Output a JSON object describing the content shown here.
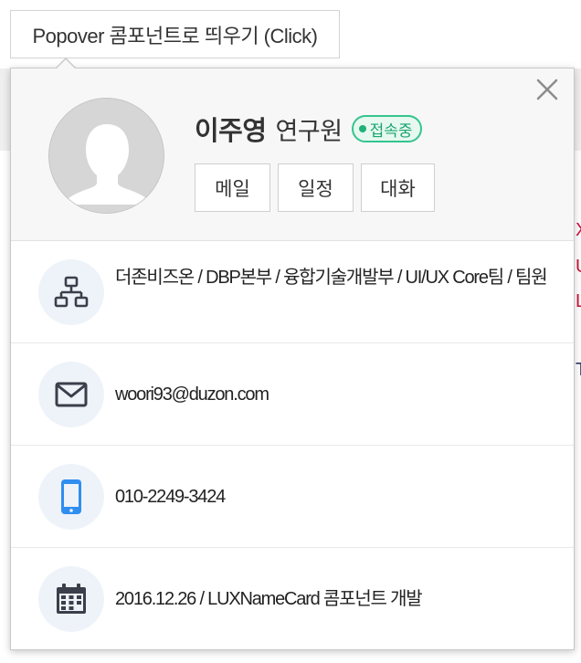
{
  "trigger": {
    "label": "Popover 콤포넌트로 띄우기 (Click)"
  },
  "profile": {
    "name": "이주영",
    "title": "연구원",
    "status": "접속중",
    "actions": [
      "메일",
      "일정",
      "대화"
    ]
  },
  "info": {
    "organization": "더존비즈온 / DBP본부 / 융합기술개발부 / UI/UX Core팀 / 팀원",
    "email": "woori93@duzon.com",
    "phone": "010-2249-3424",
    "note": "2016.12.26 / LUXNameCard 콤포넌트 개발"
  },
  "colors": {
    "status_green": "#1fb277",
    "icon_blue": "#2f8ef0",
    "icon_dark": "#3a3f4b",
    "icon_bg": "#eef3f9"
  },
  "icons": [
    "close-icon",
    "avatar-silhouette-icon",
    "org-chart-icon",
    "mail-icon",
    "phone-icon",
    "calendar-icon"
  ]
}
